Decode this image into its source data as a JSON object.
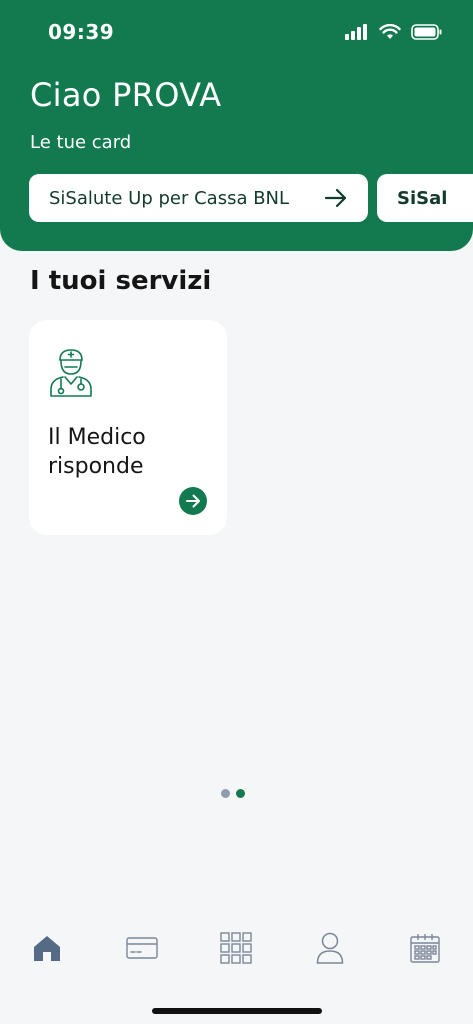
{
  "status_bar": {
    "time": "09:39"
  },
  "header": {
    "greeting": "Ciao PROVA",
    "cards_label": "Le tue card",
    "cards": [
      {
        "label": "SiSalute Up per Cassa BNL"
      },
      {
        "label": "SiSal"
      }
    ]
  },
  "services": {
    "title": "I tuoi servizi",
    "items": [
      {
        "name_line1": "Il Medico",
        "name_line2": "risponde",
        "icon": "doctor-icon"
      }
    ]
  },
  "pagination": {
    "count": 2,
    "active_index": 1
  },
  "tabbar": {
    "items": [
      {
        "icon": "home-icon",
        "active": true
      },
      {
        "icon": "card-icon",
        "active": false
      },
      {
        "icon": "grid-icon",
        "active": false
      },
      {
        "icon": "profile-icon",
        "active": false
      },
      {
        "icon": "calendar-icon",
        "active": false
      }
    ]
  },
  "colors": {
    "brand_green": "#127a4e",
    "background": "#f5f6f8",
    "dot_inactive": "#8e9bb0",
    "tab_inactive": "#7b8798",
    "tab_active": "#556a85"
  }
}
